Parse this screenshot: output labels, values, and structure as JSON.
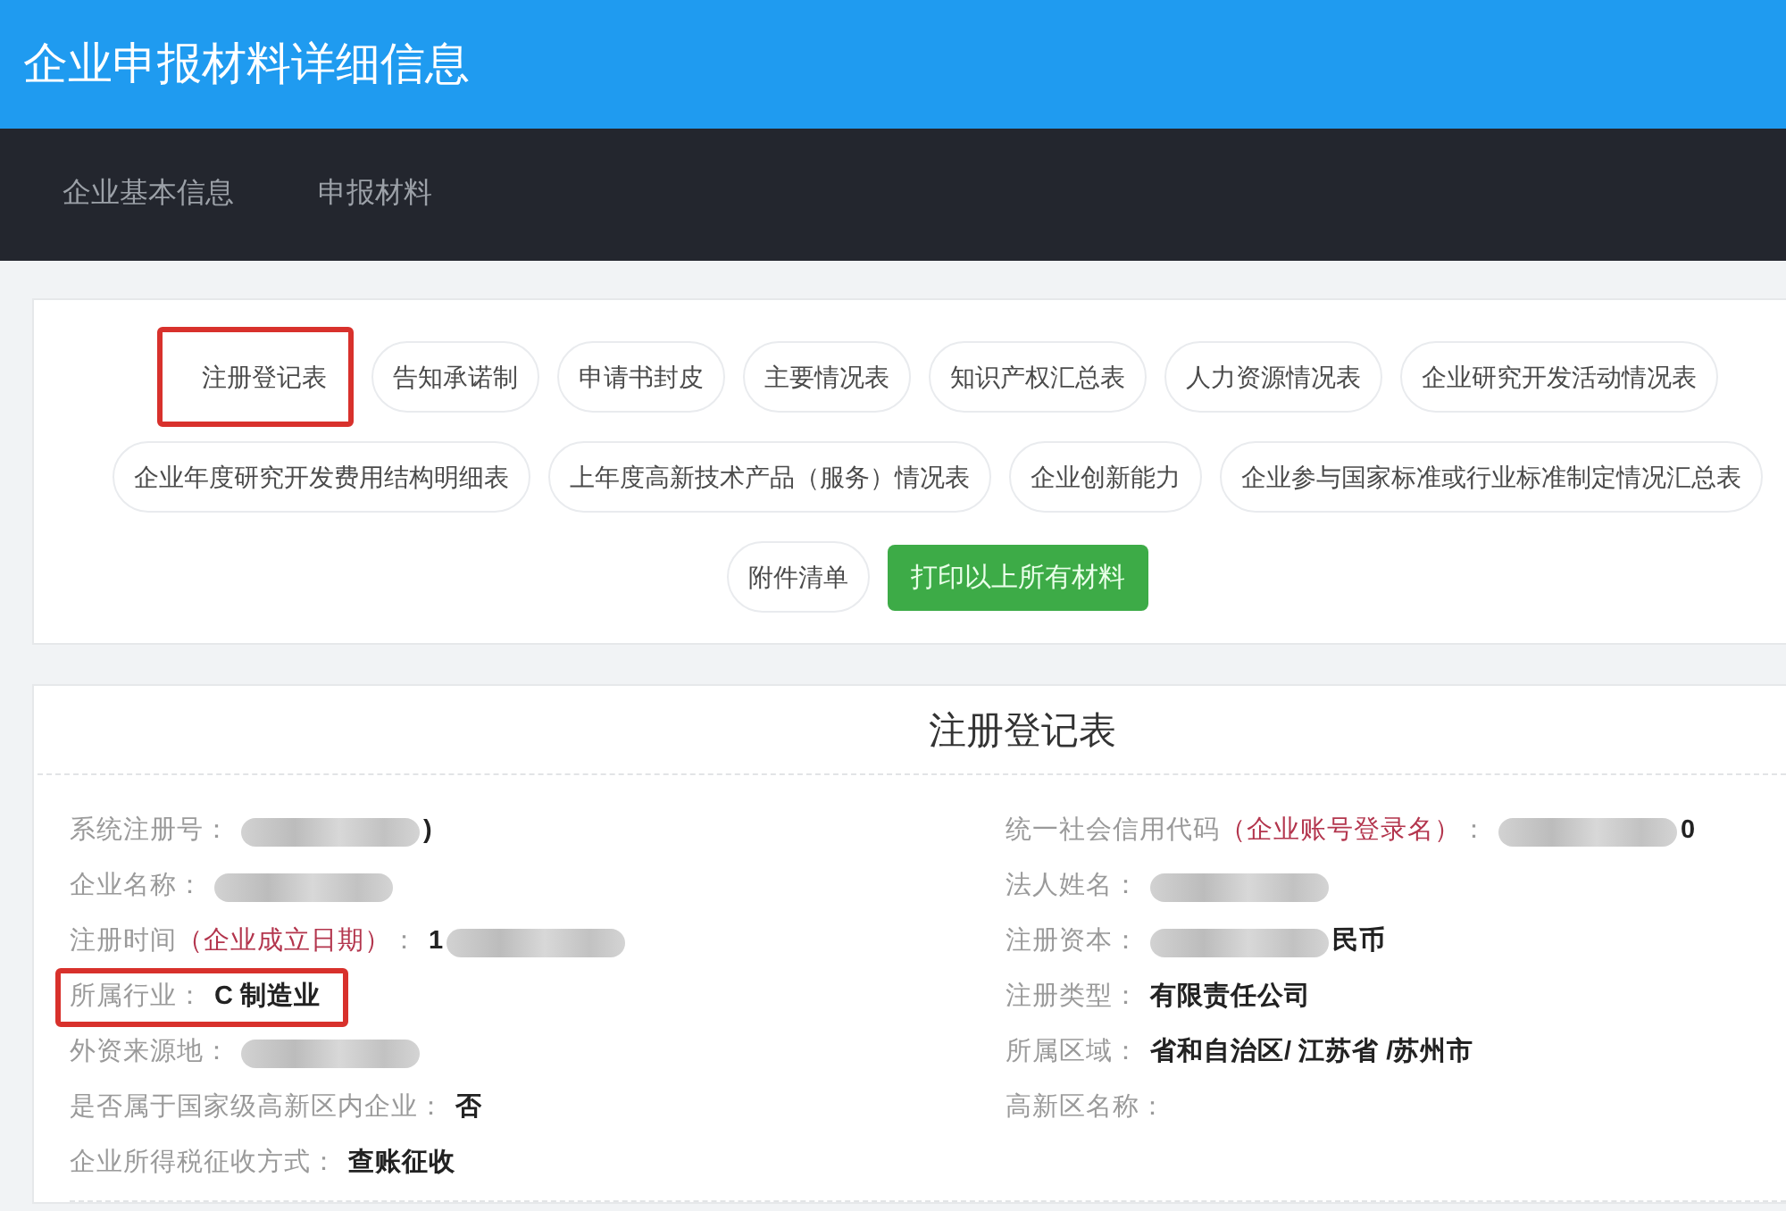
{
  "header": {
    "title": "企业申报材料详细信息"
  },
  "nav": {
    "items": [
      "企业基本信息",
      "申报材料"
    ]
  },
  "materials": {
    "tabs": [
      {
        "label": "注册登记表",
        "selected": true
      },
      {
        "label": "告知承诺制",
        "selected": false
      },
      {
        "label": "申请书封皮",
        "selected": false
      },
      {
        "label": "主要情况表",
        "selected": false
      },
      {
        "label": "知识产权汇总表",
        "selected": false
      },
      {
        "label": "人力资源情况表",
        "selected": false
      },
      {
        "label": "企业研究开发活动情况表",
        "selected": false
      },
      {
        "label": "企业年度研究开发费用结构明细表",
        "selected": false
      },
      {
        "label": "上年度高新技术产品（服务）情况表",
        "selected": false
      },
      {
        "label": "企业创新能力",
        "selected": false
      },
      {
        "label": "企业参与国家标准或行业标准制定情况汇总表",
        "selected": false
      },
      {
        "label": "附件清单",
        "selected": false
      }
    ],
    "print_button": {
      "label": "打印以上所有材料"
    }
  },
  "form": {
    "title": "注册登记表",
    "columns": [
      {
        "fields": [
          {
            "label": "系统注册号：",
            "highlighted": false,
            "value": [
              {
                "kind": "redacted"
              },
              {
                "kind": "text",
                "text": ")"
              }
            ]
          },
          {
            "label": "企业名称：",
            "highlighted": false,
            "value": [
              {
                "kind": "redacted"
              }
            ]
          },
          {
            "label": "注册时间",
            "note": "（企业成立日期）",
            "label_end": "：",
            "highlighted": false,
            "value": [
              {
                "kind": "text",
                "text": "1"
              },
              {
                "kind": "redacted"
              }
            ]
          },
          {
            "label": "所属行业：",
            "highlighted": true,
            "value": [
              {
                "kind": "text",
                "text": "C 制造业"
              }
            ]
          },
          {
            "label": "外资来源地：",
            "highlighted": false,
            "value": [
              {
                "kind": "redacted"
              }
            ]
          },
          {
            "label": "是否属于国家级高新区内企业：",
            "highlighted": false,
            "value": [
              {
                "kind": "text",
                "text": "否"
              }
            ]
          },
          {
            "label": "企业所得税征收方式：",
            "highlighted": false,
            "value": [
              {
                "kind": "text",
                "text": "查账征收"
              }
            ]
          }
        ]
      },
      {
        "fields": [
          {
            "label": "统一社会信用代码",
            "note": "（企业账号登录名）",
            "label_end": "：",
            "highlighted": false,
            "value": [
              {
                "kind": "redacted"
              },
              {
                "kind": "text",
                "text": "0"
              }
            ]
          },
          {
            "label": "法人姓名：",
            "highlighted": false,
            "value": [
              {
                "kind": "redacted"
              }
            ]
          },
          {
            "label": "注册资本：",
            "highlighted": false,
            "value": [
              {
                "kind": "redacted"
              },
              {
                "kind": "text",
                "text": "民币"
              }
            ]
          },
          {
            "label": "注册类型：",
            "highlighted": false,
            "value": [
              {
                "kind": "text",
                "text": "有限责任公司"
              }
            ]
          },
          {
            "label": "所属区域：",
            "highlighted": false,
            "value": [
              {
                "kind": "text",
                "text": "省和自治区/ 江苏省 /苏州市"
              }
            ]
          },
          {
            "label": "高新区名称：",
            "highlighted": false
          }
        ]
      }
    ]
  }
}
